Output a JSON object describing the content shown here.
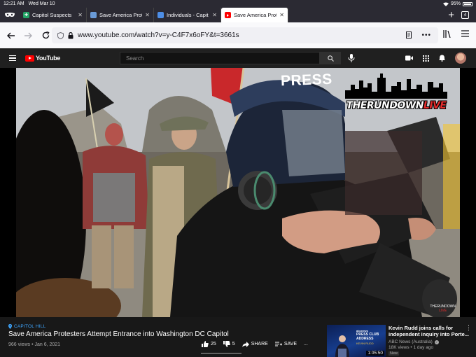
{
  "status": {
    "time": "12:21 AM",
    "date": "Wed Mar 10",
    "battery": "95%"
  },
  "tabs": [
    {
      "title": "Capitol Suspects",
      "favicon": "green-sheet-icon",
      "color": "#23a566",
      "active": false
    },
    {
      "title": "Save America Prot",
      "favicon": "youtube-tv-icon",
      "color": "#6a9bd8",
      "active": false
    },
    {
      "title": "Individuals - Capit",
      "favicon": "doc-blue-icon",
      "color": "#4d8ee6",
      "active": false
    },
    {
      "title": "Save America Prot",
      "favicon": "youtube-icon",
      "color": "#ff0000",
      "active": true
    }
  ],
  "tab_count": "4",
  "urlbar": {
    "url": "www.youtube.com/watch?v=y-C4F7x6oFY&t=3661s"
  },
  "youtube": {
    "logo": "YouTube",
    "search_placeholder": "Search"
  },
  "video_overlay": {
    "press_text": "PRESS",
    "watermark_main": "THERUNDOWN",
    "watermark_accent": "LIVE",
    "small_watermark_top": "THERUNDOWN",
    "small_watermark_bottom": "LIVE"
  },
  "video": {
    "location": "CAPITOL HILL",
    "title": "Save America Protesters Attempt Entrance into Washington DC Capitol",
    "meta": "966 views • Jan 6, 2021",
    "likes": "25",
    "dislikes": "5",
    "share_label": "SHARE",
    "save_label": "SAVE",
    "more_label": "..."
  },
  "recommended": {
    "title_line1": "Kevin Rudd joins calls for",
    "title_line2": "independent inquiry into Porte...",
    "channel": "ABC News (Australia)",
    "meta": "18K views • 1 day ago",
    "badge": "New",
    "duration": "1:05:50",
    "thumb_brand": "abcnews",
    "thumb_headline_1": "PRESS CLUB",
    "thumb_headline_2": "ADDRESS",
    "thumb_sub": "KEVIN RUDD"
  },
  "colors": {
    "youtube_red": "#ff0000",
    "link_blue": "#3ea6ff",
    "dark_bg": "#181818"
  }
}
